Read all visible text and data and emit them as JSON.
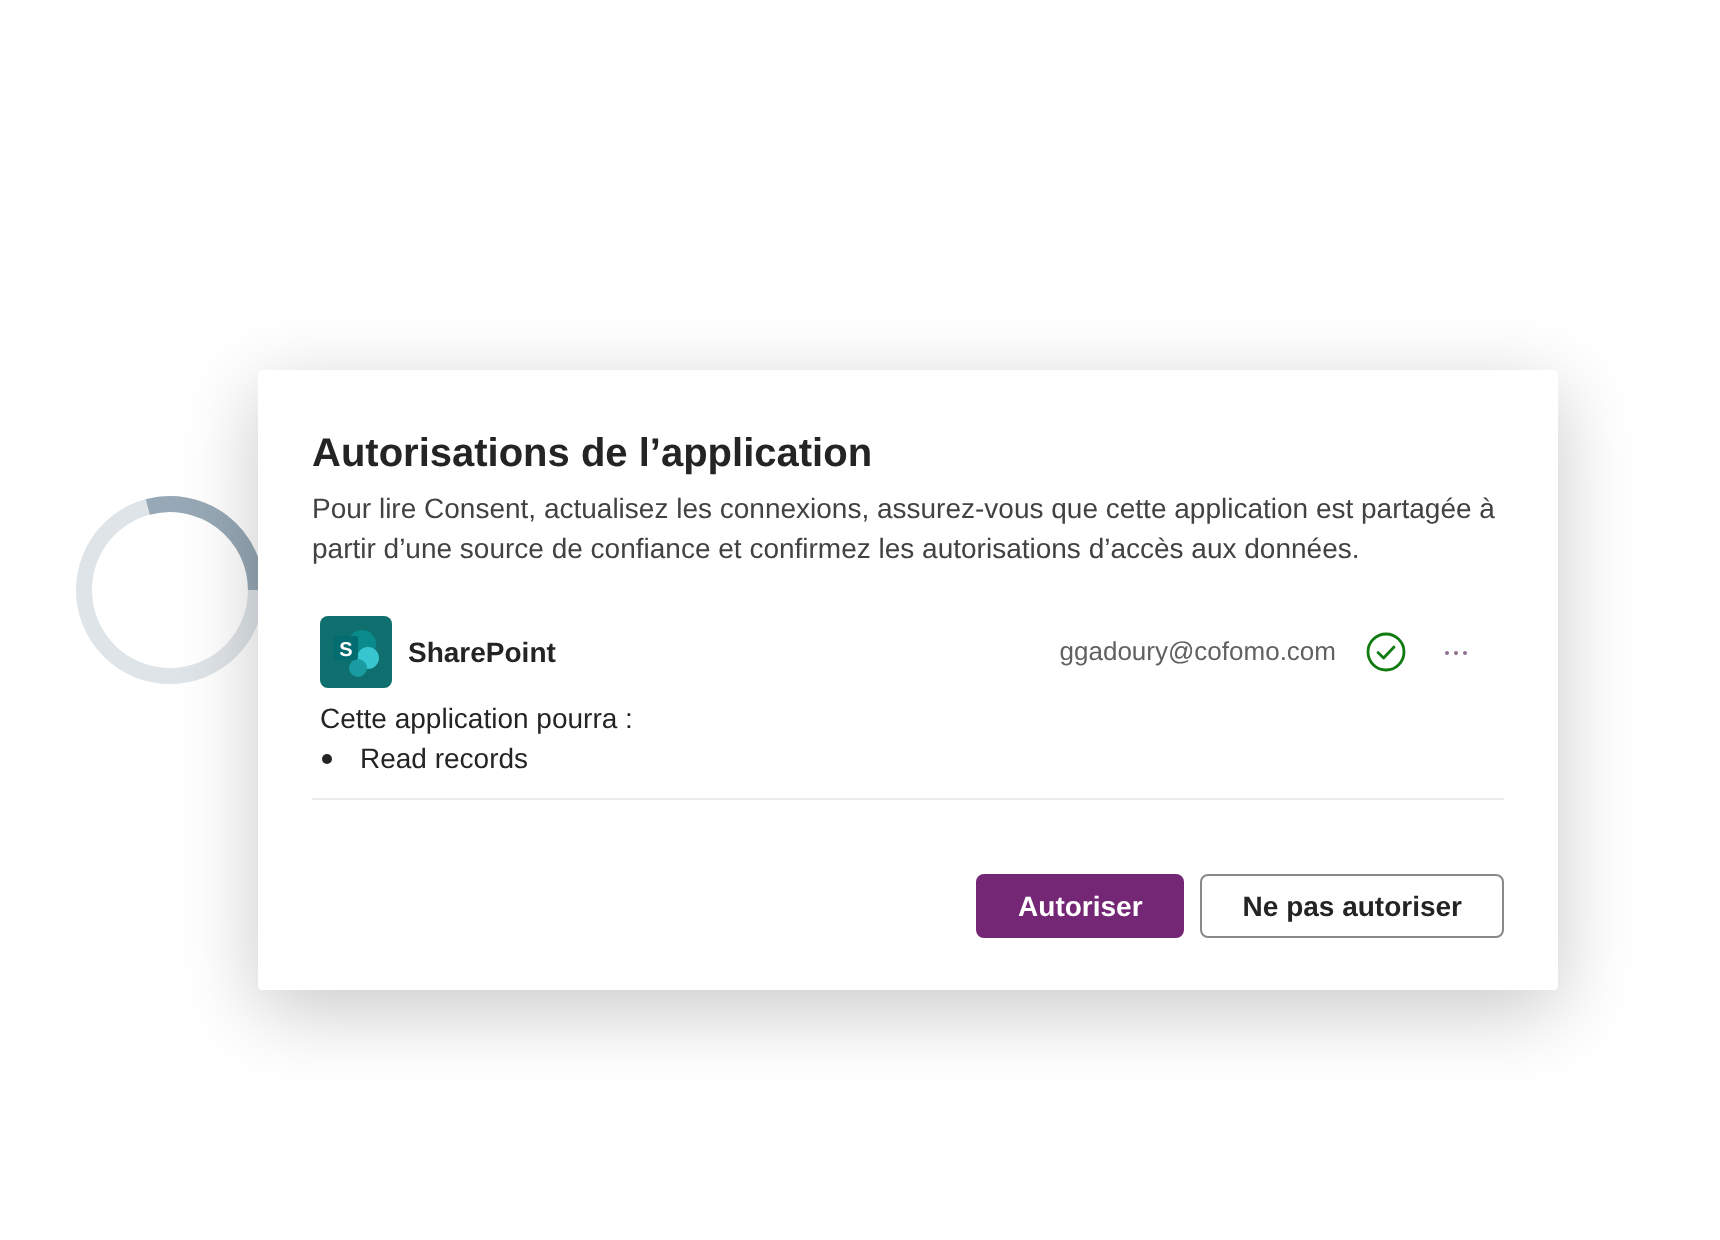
{
  "dialog": {
    "title": "Autorisations de l’application",
    "description": "Pour lire Consent, actualisez les connexions, assurez-vous que cette application est partagée à partir d’une source de confiance et confirmez les autorisations d’accès aux données.",
    "connections": [
      {
        "name": "SharePoint",
        "logo_letter": "S",
        "account": "ggadoury@cofomo.com",
        "connected": true
      }
    ],
    "permissions_heading": "Cette application pourra :",
    "permissions": [
      "Read records"
    ],
    "buttons": [
      {
        "label": "Autoriser",
        "kind": "primary"
      },
      {
        "label": "Ne pas autoriser",
        "kind": "secondary"
      }
    ]
  }
}
